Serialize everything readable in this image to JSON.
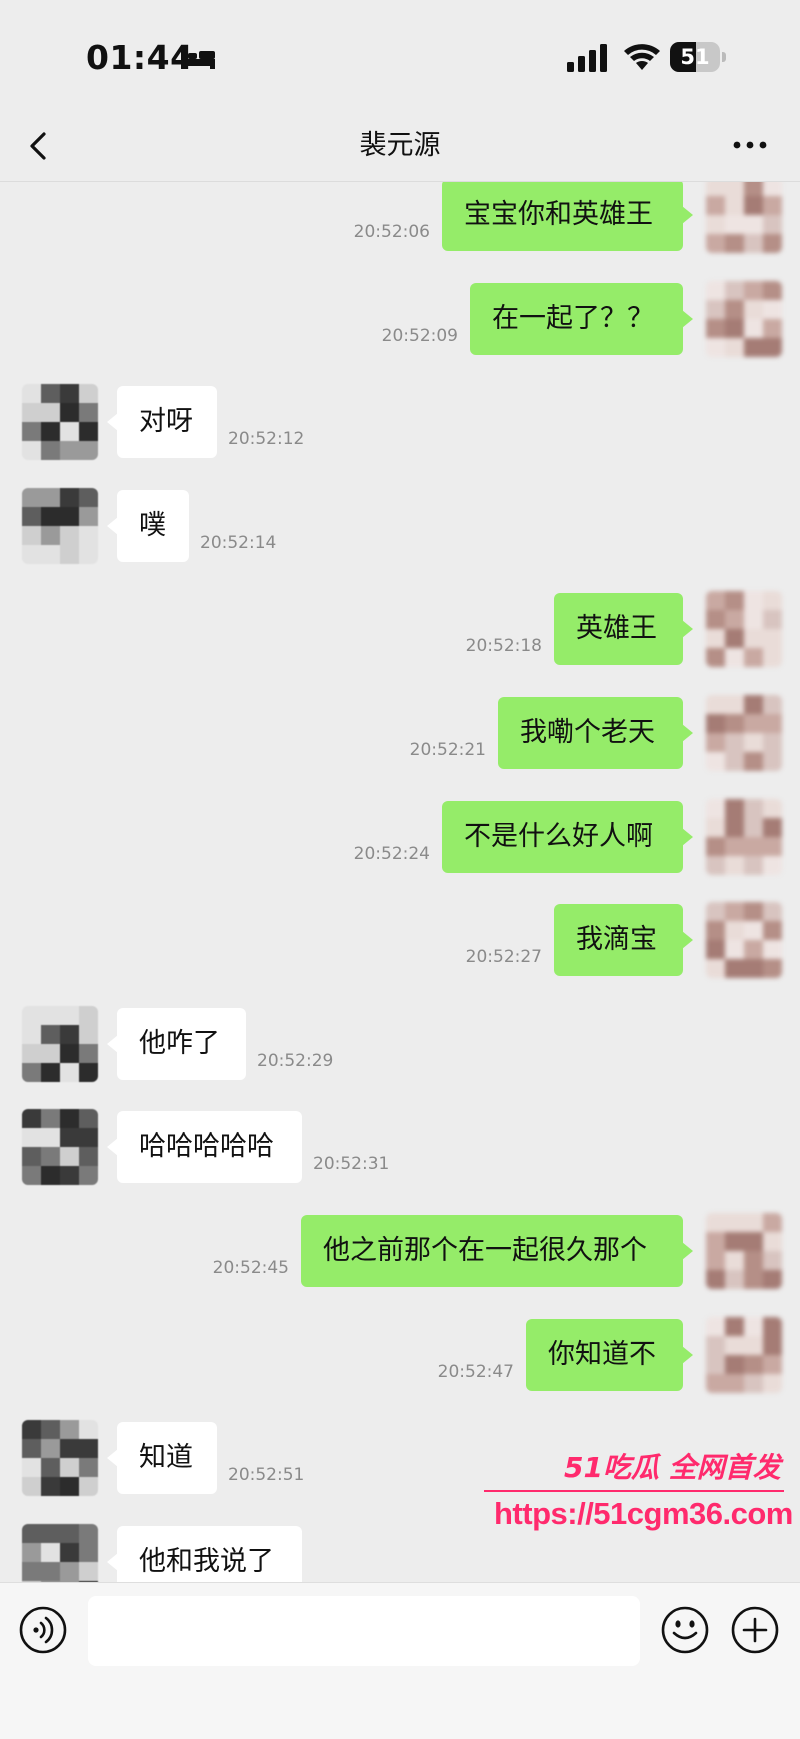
{
  "status_bar": {
    "time": "01:44",
    "battery_level": "51",
    "battery_fraction": 0.51,
    "icons": [
      "bed-icon",
      "cellular-signal-icon",
      "wifi-icon",
      "battery-icon"
    ]
  },
  "nav": {
    "title": "裴元源",
    "back_icon": "chevron-left-icon",
    "more_icon": "more-icon"
  },
  "messages": [
    {
      "sender": "self",
      "text": "宝宝你和英雄王",
      "time": "20:52:06"
    },
    {
      "sender": "self",
      "text": "在一起了？？",
      "time": "20:52:09"
    },
    {
      "sender": "other",
      "text": "对呀",
      "time": "20:52:12"
    },
    {
      "sender": "other",
      "text": "噗",
      "time": "20:52:14"
    },
    {
      "sender": "self",
      "text": "英雄王",
      "time": "20:52:18"
    },
    {
      "sender": "self",
      "text": "我嘞个老天",
      "time": "20:52:21"
    },
    {
      "sender": "self",
      "text": "不是什么好人啊",
      "time": "20:52:24"
    },
    {
      "sender": "self",
      "text": "我滴宝",
      "time": "20:52:27"
    },
    {
      "sender": "other",
      "text": "他咋了",
      "time": "20:52:29"
    },
    {
      "sender": "other",
      "text": "哈哈哈哈哈",
      "time": "20:52:31"
    },
    {
      "sender": "self",
      "text": "他之前那个在一起很久那个",
      "time": "20:52:45"
    },
    {
      "sender": "self",
      "text": "你知道不",
      "time": "20:52:47"
    },
    {
      "sender": "other",
      "text": "知道",
      "time": "20:52:51"
    },
    {
      "sender": "other",
      "text": "他和我说了",
      "time": ""
    }
  ],
  "watermark": {
    "brand": "51吃瓜 全网首发",
    "url": "https://51cgm36.com"
  },
  "input_bar": {
    "placeholder": "",
    "icons": [
      "voice-icon",
      "emoji-icon",
      "add-icon"
    ]
  },
  "colors": {
    "background": "#ededed",
    "self_bubble": "#95ec69",
    "other_bubble": "#ffffff",
    "timestamp": "#8a8a8a",
    "watermark": "#ff2a6d"
  }
}
